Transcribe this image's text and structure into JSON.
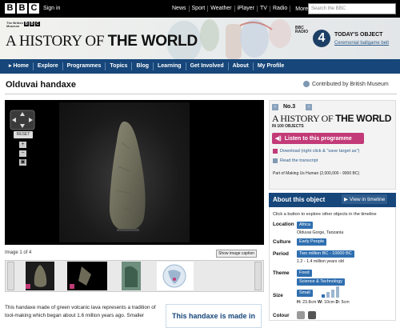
{
  "bbc_bar": {
    "logo_letters": [
      "B",
      "B",
      "C"
    ],
    "sign_in": "Sign in",
    "links": [
      "News",
      "Sport",
      "Weather",
      "iPlayer",
      "TV",
      "Radio",
      "More"
    ],
    "more_arrow": "▾",
    "search_placeholder": "Search the BBC"
  },
  "banner": {
    "museum_line1": "The British",
    "museum_line2": "Museum",
    "title_thin": "A HISTORY OF",
    "title_bold": "THE WORLD",
    "radio_label1": "BBC",
    "radio_label2": "RADIO",
    "radio_number": "4",
    "today_label": "TODAY'S OBJECT",
    "today_object": "Ceremonial ballgame belt"
  },
  "main_nav": {
    "items": [
      "Home",
      "Explore",
      "Programmes",
      "Topics",
      "Blog",
      "Learning",
      "Get Involved",
      "About",
      "My Profile"
    ],
    "home_arrow": "▸"
  },
  "page": {
    "title": "Olduvai handaxe",
    "contributed": "Contributed by British Museum"
  },
  "viewer": {
    "reset_label": "RESET",
    "zoom_in": "+",
    "zoom_out": "−",
    "fullscreen_icon": "▣",
    "image_counter": "Image 1 of 4",
    "show_caption": "Show image caption"
  },
  "description": {
    "text": "This handaxe made of green volcanic lava represents a tradition of tool-making which began about 1.6 million years ago. Smaller",
    "pull_quote": "This handaxe is made in"
  },
  "programme": {
    "number": "No.3",
    "title_thin": "A HISTORY OF",
    "title_bold": "THE WORLD",
    "subtitle": "IN 100 OBJECTS",
    "listen": "Listen to this programme",
    "download": "Download (right click & \"save target as\")",
    "transcript": "Read the transcript",
    "part_of": "Part of Making Us Human (2,000,000 - 9000 BC)"
  },
  "about": {
    "heading": "About this object",
    "timeline": "View in timeline",
    "hint": "Click a button to explore other objects in the timeline",
    "location_label": "Location",
    "location_tag": "Africa",
    "location_sub": "Olduvai Gorge, Tanzania",
    "culture_label": "Culture",
    "culture_tag": "Early People",
    "period_label": "Period",
    "period_tag": "Two million BC - 10000 BC",
    "period_sub": "1.2 - 1.4 million years old",
    "theme_label": "Theme",
    "theme_tags": [
      "Food",
      "Science &amp; Technology"
    ],
    "size_label": "Size",
    "size_tag": "Small",
    "size_sub_h": "H:",
    "size_sub_hv": "23.8cm",
    "size_sub_w": "W:",
    "size_sub_wv": "10cm",
    "size_sub_d": "D:",
    "size_sub_dv": "5cm",
    "colour_label": "Colour",
    "colours": [
      "#9a9a9a",
      "#555555"
    ]
  }
}
